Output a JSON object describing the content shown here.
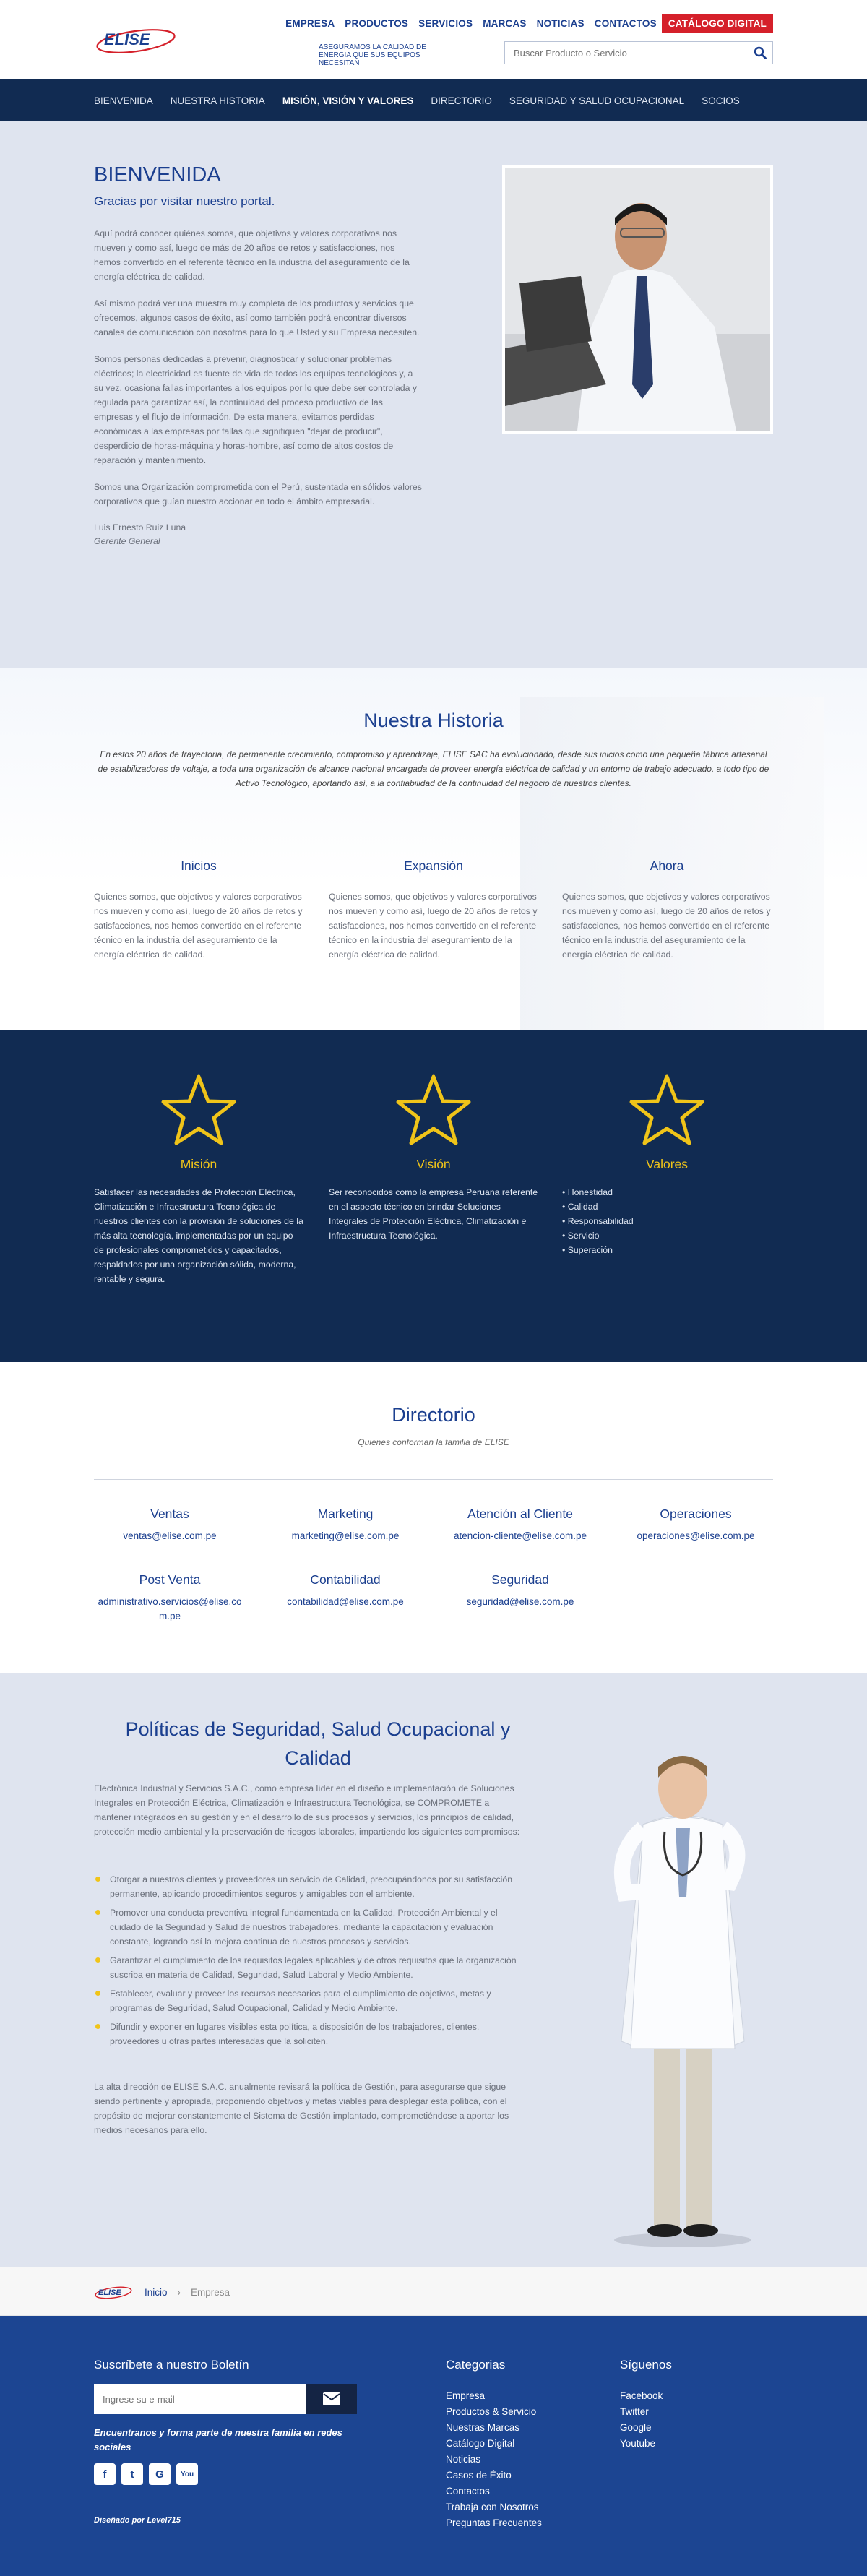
{
  "header": {
    "logo_text": "ELISE",
    "tagline": "Aseguramos la calidad de energía que sus equipos necesitan",
    "top_nav": [
      "EMPRESA",
      "PRODUCTOS",
      "SERVICIOS",
      "MARCAS",
      "NOTICIAS",
      "CONTACTOS"
    ],
    "catalog_label": "CATÁLOGO DIGITAL",
    "search_placeholder": "Buscar Producto o Servicio"
  },
  "main_nav": [
    "BIENVENIDA",
    "NUESTRA HISTORIA",
    "MISIÓN, VISIÓN Y VALORES",
    "DIRECTORIO",
    "SEGURIDAD Y SALUD OCUPACIONAL",
    "SOCIOS"
  ],
  "main_nav_active": "MISIÓN, VISIÓN Y VALORES",
  "welcome": {
    "title": "BIENVENIDA",
    "subtitle": "Gracias por visitar nuestro portal.",
    "paragraphs": [
      "Aquí podrá conocer quiénes somos, que objetivos y valores corporativos nos mueven y como así, luego de más de 20 años de retos y satisfacciones, nos hemos convertido en el referente técnico en la industria del aseguramiento de la energía eléctrica de calidad.",
      "Así mismo podrá ver una muestra muy completa de los productos y servicios que ofrecemos, algunos casos de éxito, así como también podrá encontrar diversos canales de comunicación con nosotros para lo que Usted y su Empresa necesiten.",
      "Somos personas dedicadas a prevenir, diagnosticar y solucionar problemas eléctricos; la electricidad es fuente de vida de todos los equipos tecnológicos y, a su vez, ocasiona fallas importantes a los equipos por lo que debe ser controlada y regulada para garantizar así, la continuidad del proceso productivo de las empresas y el flujo de información. De esta manera, evitamos perdidas económicas a las empresas por fallas que signifiquen \"dejar de producir\", desperdicio de horas-máquina y horas-hombre, así como de altos costos de reparación y mantenimiento.",
      "Somos una Organización comprometida con el Perú, sustentada en sólidos valores corporativos que guían nuestro accionar en todo el ámbito empresarial."
    ],
    "signature_name": "Luis Ernesto Ruiz Luna",
    "signature_role": "Gerente General"
  },
  "history": {
    "title": "Nuestra Historia",
    "lead": "En estos 20 años de trayectoria, de permanente crecimiento, compromiso y aprendizaje, ELISE SAC ha evolucionado, desde sus inicios como una pequeña fábrica artesanal de estabilizadores de voltaje, a toda una organización de alcance nacional encargada de proveer energía eléctrica de calidad y un entorno de trabajo adecuado, a todo tipo de Activo Tecnológico, aportando así, a la confiabilidad de la continuidad del negocio de nuestros clientes.",
    "columns": [
      {
        "title": "Inicios",
        "text": "Quienes somos, que objetivos y valores corporativos nos mueven y como así, luego de 20 años de retos y satisfacciones, nos hemos convertido en el referente técnico en la industria del aseguramiento de la energía eléctrica de calidad."
      },
      {
        "title": "Expansión",
        "text": "Quienes somos, que objetivos y valores corporativos nos mueven y como así, luego de 20 años de retos y satisfacciones, nos hemos convertido en el referente técnico en la industria del aseguramiento de la energía eléctrica de calidad."
      },
      {
        "title": "Ahora",
        "text": "Quienes somos, que objetivos y valores corporativos nos mueven y como así, luego de 20 años de retos y satisfacciones, nos hemos convertido en el referente técnico en la industria del aseguramiento de la energía eléctrica de calidad."
      }
    ]
  },
  "mission": {
    "columns": [
      {
        "title": "Misión",
        "text": "Satisfacer las necesidades de Protección Eléctrica, Climatización e Infraestructura Tecnológica de nuestros clientes con la provisión de soluciones de la más alta tecnología, implementadas por un equipo de profesionales comprometidos y capacitados, respaldados por una organización sólida, moderna, rentable y segura."
      },
      {
        "title": "Visión",
        "text": "Ser reconocidos como la empresa Peruana referente en el aspecto técnico en brindar Soluciones Integrales de Protección Eléctrica, Climatización e Infraestructura Tecnológica."
      },
      {
        "title": "Valores",
        "items": [
          "Honestidad",
          "Calidad",
          "Responsabilidad",
          "Servicio",
          "Superación"
        ]
      }
    ],
    "star_color": "#f0c419"
  },
  "directory": {
    "title": "Directorio",
    "subtitle": "Quienes conforman la familia de ELISE",
    "entries": [
      {
        "area": "Ventas",
        "email": "ventas@elise.com.pe"
      },
      {
        "area": "Marketing",
        "email": "marketing@elise.com.pe"
      },
      {
        "area": "Atención al Cliente",
        "email": "atencion-cliente@elise.com.pe"
      },
      {
        "area": "Operaciones",
        "email": "operaciones@elise.com.pe"
      },
      {
        "area": "Post Venta",
        "email": "administrativo.servicios@elise.com.pe"
      },
      {
        "area": "Contabilidad",
        "email": "contabilidad@elise.com.pe"
      },
      {
        "area": "Seguridad",
        "email": "seguridad@elise.com.pe"
      }
    ]
  },
  "policies": {
    "title": "Políticas de Seguridad, Salud Ocupacional y Calidad",
    "intro": "Electrónica Industrial y Servicios S.A.C., como empresa líder en el diseño e implementación de Soluciones Integrales en Protección Eléctrica, Climatización e Infraestructura Tecnológica, se COMPROMETE a mantener integrados en su gestión y en el desarrollo de sus procesos y servicios, los principios de calidad, protección medio ambiental y la preservación de riesgos laborales, impartiendo los siguientes compromisos:",
    "items": [
      "Otorgar a nuestros clientes y proveedores un servicio de Calidad, preocupándonos por su satisfacción permanente, aplicando procedimientos seguros y amigables con el ambiente.",
      "Promover una conducta preventiva integral fundamentada en la Calidad, Protección Ambiental y el cuidado de la Seguridad y Salud de nuestros trabajadores, mediante la capacitación y evaluación constante, logrando así la mejora continua de nuestros procesos y servicios.",
      "Garantizar el cumplimiento de los requisitos legales aplicables y de otros requisitos que la organización suscriba en materia de Calidad, Seguridad, Salud Laboral y Medio Ambiente.",
      "Establecer, evaluar y proveer los recursos necesarios para el cumplimiento de objetivos, metas y programas de Seguridad, Salud Ocupacional, Calidad y Medio Ambiente.",
      "Difundir y exponer en lugares visibles esta política, a disposición de los trabajadores, clientes, proveedores u otras partes interesadas que la soliciten."
    ],
    "outro": "La alta dirección de ELISE S.A.C. anualmente revisará la política de Gestión, para asegurarse que sigue siendo pertinente y apropiada, proponiendo objetivos y metas viables para desplegar esta política, con el propósito de mejorar constantemente el Sistema de Gestión implantado, comprometiéndose a aportar los medios necesarios para ello."
  },
  "breadcrumb": {
    "home": "Inicio",
    "current": "Empresa"
  },
  "footer": {
    "newsletter_title": "Suscríbete a nuestro Boletín",
    "email_placeholder": "Ingrese su e-mail",
    "join_text": "Encuentranos y forma parte de nuestra familia en redes sociales",
    "designed_by": "Diseñado por Level715",
    "social_icons": [
      "facebook-icon",
      "twitter-icon",
      "google-plus-icon",
      "youtube-icon"
    ],
    "categories_title": "Categorias",
    "categories": [
      "Empresa",
      "Productos & Servicio",
      "Nuestras Marcas",
      "Catálogo Digital",
      "Noticias",
      "Casos de Éxito",
      "Contactos",
      "Trabaja con Nosotros",
      "Preguntas Frecuentes"
    ],
    "follow_title": "Síguenos",
    "follow": [
      "Facebook",
      "Twitter",
      "Google",
      "Youtube"
    ]
  },
  "colors": {
    "brand_blue": "#1b3f8f",
    "nav_dark": "#112b52",
    "accent_red": "#d5202a",
    "accent_yellow": "#f0c419",
    "footer_blue": "#1c4592"
  }
}
